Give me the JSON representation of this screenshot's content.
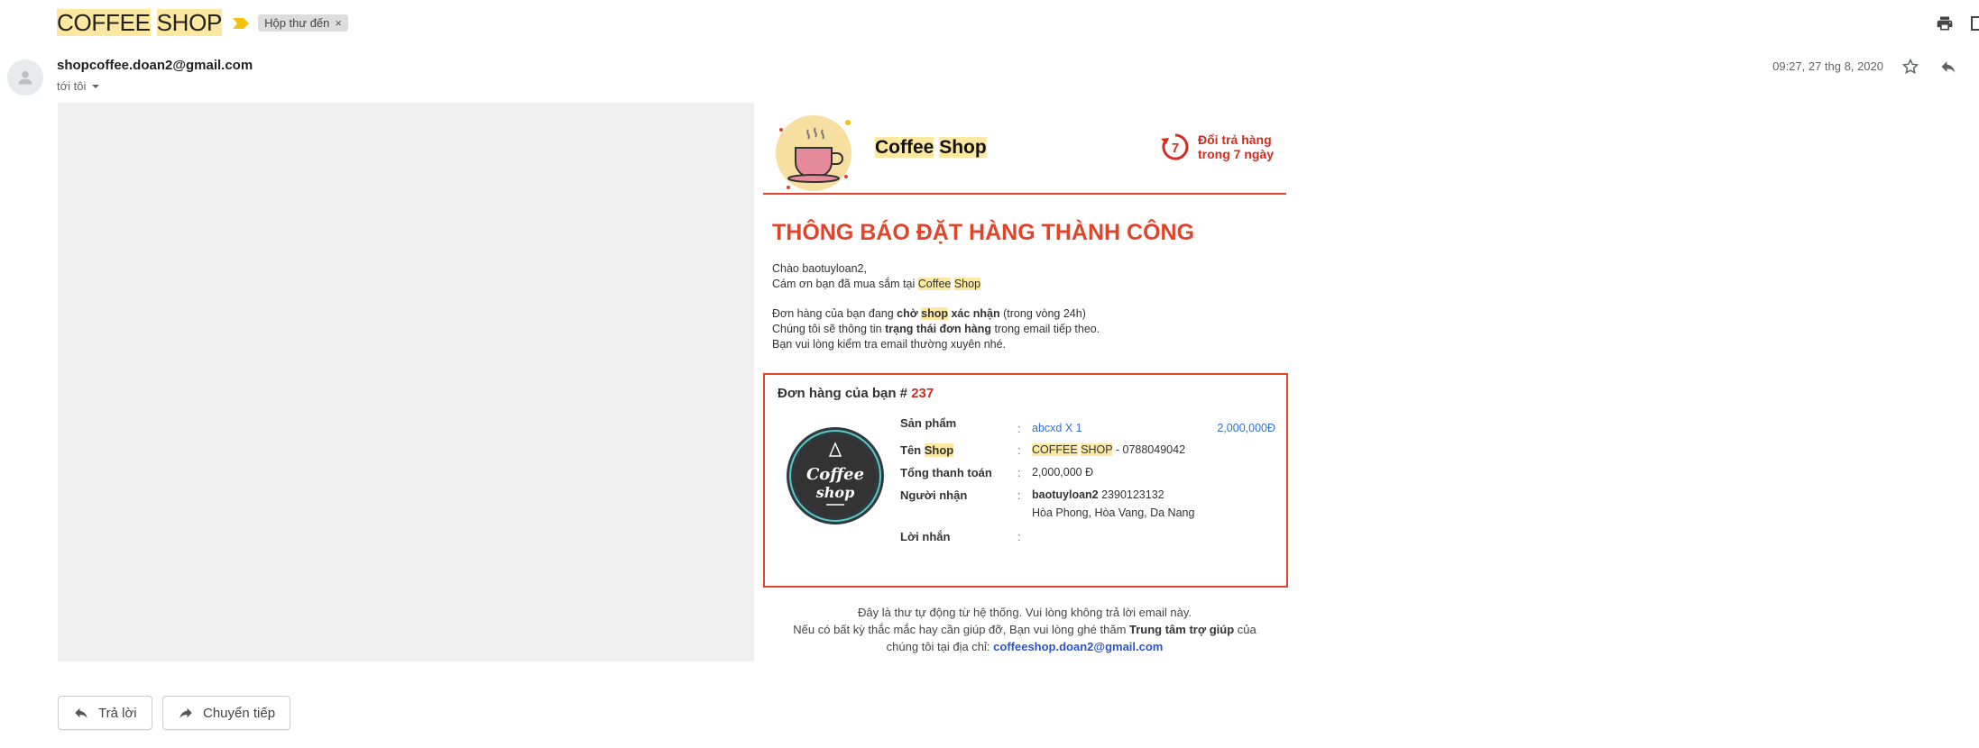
{
  "email": {
    "subject": {
      "part1": "COFFEE",
      "part2": "SHOP"
    },
    "label": "Hộp thư đến",
    "label_remove": "×",
    "sender": "shopcoffee.doan2@gmail.com",
    "to": "tới tôi",
    "date": "09:27, 27 thg 8, 2020"
  },
  "card": {
    "brand": {
      "part1": "Coffee",
      "part2": "Shop"
    },
    "return_policy": {
      "days": "7",
      "line1": "Đổi trả hàng",
      "line2": "trong 7 ngày"
    },
    "title": "THÔNG BÁO ĐẶT HÀNG THÀNH CÔNG",
    "greeting": "Chào baotuyloan2,",
    "thanks_prefix": "Cám ơn bạn đã mua sắm tại ",
    "thanks_shop1": "Coffee",
    "thanks_shop2": "Shop",
    "status_prefix": "Đơn hàng của bạn đang ",
    "status_bold1": "chờ ",
    "status_hl": "shop",
    "status_bold2": " xác nhận",
    "status_suffix": " (trong vòng 24h)",
    "notify_prefix": "Chúng tôi sẽ thông tin ",
    "notify_bold": "trạng thái đơn hàng",
    "notify_suffix": " trong email tiếp theo.",
    "check_email": "Bạn vui lòng kiểm tra email thường xuyên nhé."
  },
  "order": {
    "title_prefix": "Đơn hàng của bạn # ",
    "number": "237",
    "logo_text1": "Coffee",
    "logo_text2": "shop",
    "rows": {
      "product_label": "Sản phẩm",
      "product_value": "abcxd X 1",
      "product_price": "2,000,000Đ",
      "shop_label_prefix": "Tên ",
      "shop_label_hl": "Shop",
      "shop_value_hl1": "COFFEE",
      "shop_value_hl2": "SHOP",
      "shop_value_phone": " - 0788049042",
      "total_label": "Tổng thanh toán",
      "total_value": "2,000,000 Đ",
      "receiver_label": "Người nhận",
      "receiver_name": "baotuyloan2",
      "receiver_phone": " 2390123132",
      "receiver_address": "Hòa Phong, Hòa Vang, Da Nang",
      "note_label": "Lời nhắn",
      "colon": ":"
    }
  },
  "footer": {
    "line1": "Đây là thư tự động từ hệ thống. Vui lòng không trả lời email này.",
    "line2_prefix": "Nếu có bất kỳ thắc mắc hay cần giúp đỡ, Bạn vui lòng ghé thăm ",
    "line2_bold": "Trung tâm trợ giúp",
    "line2_suffix": " của",
    "line3_prefix": "chúng tôi tại địa chỉ: ",
    "line3_email": "coffeeshop.doan2@gmail.com"
  },
  "actions": {
    "reply": "Trả lời",
    "forward": "Chuyển tiếp"
  },
  "colors": {
    "accent": "#e0442a",
    "highlight": "#fce8a0",
    "link": "#2a56c6"
  },
  "icons": [
    "importance-marker-icon",
    "print-icon",
    "open-new-window-icon",
    "person-avatar-icon",
    "chevron-down-icon",
    "star-icon",
    "reply-icon",
    "coffee-cup-icon",
    "return-7-days-icon",
    "forward-icon"
  ]
}
